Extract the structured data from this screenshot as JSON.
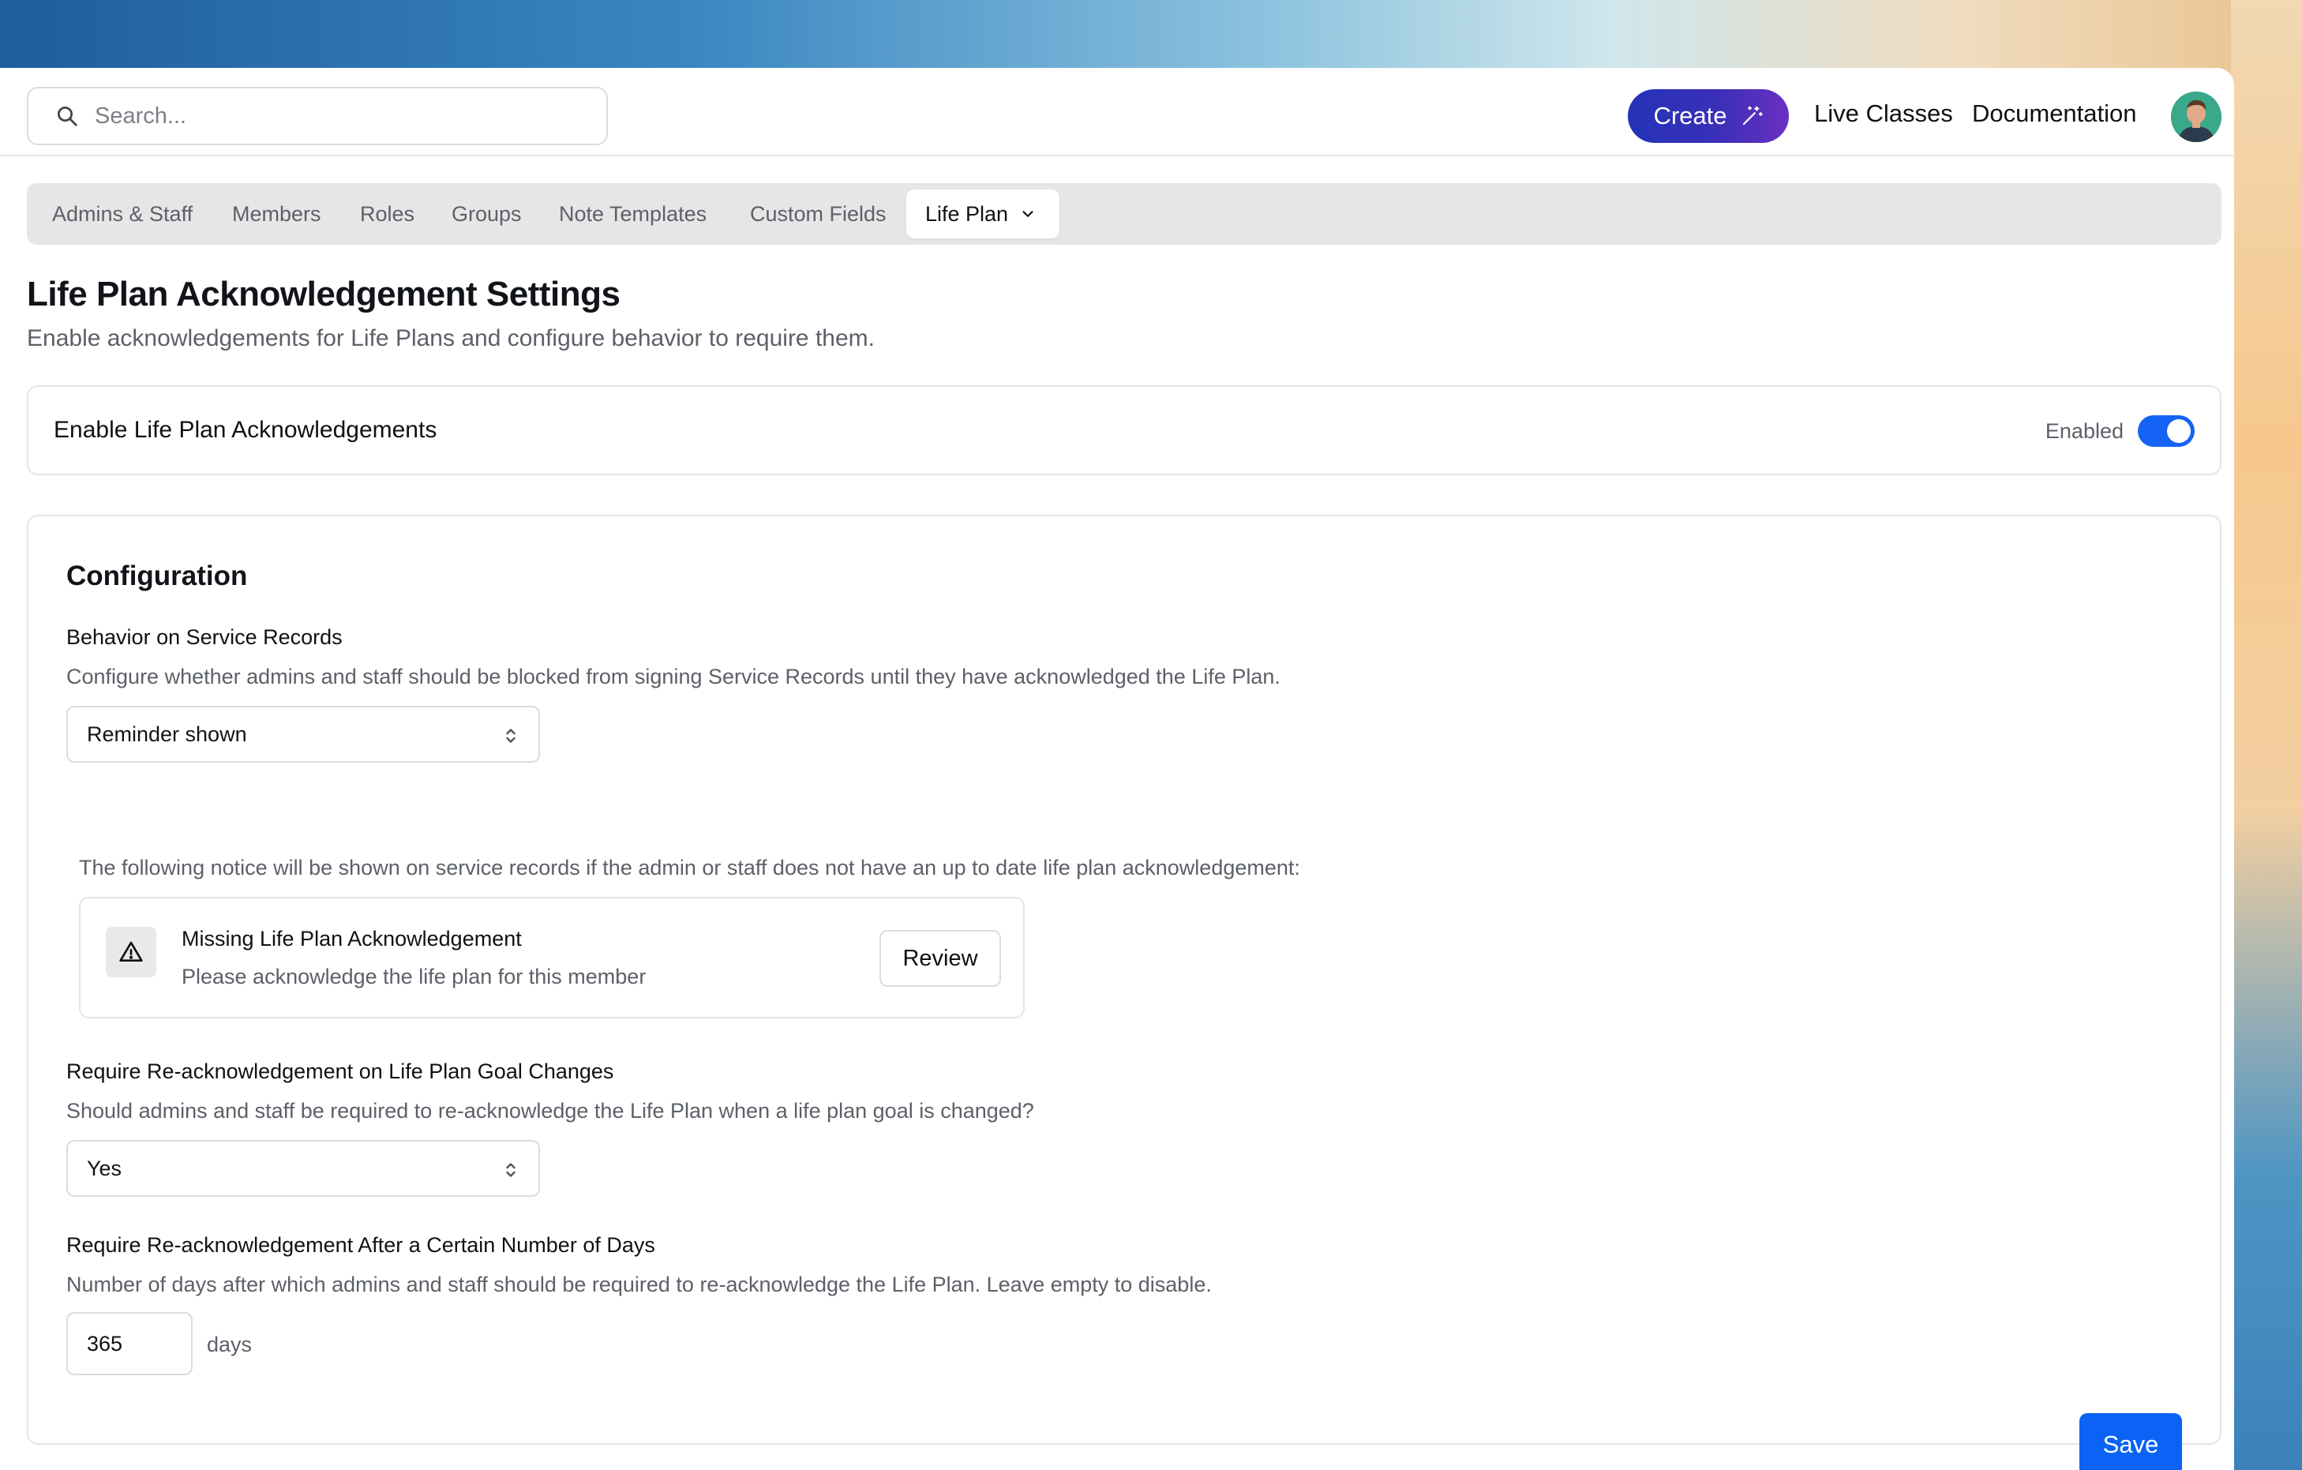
{
  "header": {
    "search": {
      "placeholder": "Search..."
    },
    "create_label": "Create",
    "links": [
      "Live Classes",
      "Documentation"
    ]
  },
  "tabs": {
    "items": [
      "Admins & Staff",
      "Members",
      "Roles",
      "Groups",
      "Note Templates",
      "Custom Fields"
    ],
    "active": "Life Plan"
  },
  "page": {
    "title": "Life Plan Acknowledgement Settings",
    "subtitle": "Enable acknowledgements for Life Plans and configure behavior to require them."
  },
  "enable_card": {
    "label": "Enable Life Plan Acknowledgements",
    "status": "Enabled",
    "toggle_on": true
  },
  "configuration": {
    "title": "Configuration",
    "behavior": {
      "label": "Behavior on Service Records",
      "description": "Configure whether admins and staff should be blocked from signing Service Records until they have acknowledged the Life Plan.",
      "value": "Reminder shown",
      "notice_intro": "The following notice will be shown on service records if the admin or staff does not have an up to date life plan acknowledgement:",
      "notice": {
        "title": "Missing Life Plan Acknowledgement",
        "text": "Please acknowledge the life plan for this member",
        "button": "Review",
        "icon": "warning-triangle-icon"
      }
    },
    "goal_changes": {
      "label": "Require Re-acknowledgement on Life Plan Goal Changes",
      "description": "Should admins and staff be required to re-acknowledge the Life Plan when a life plan goal is changed?",
      "value": "Yes"
    },
    "days": {
      "label": "Require Re-acknowledgement After a Certain Number of Days",
      "description": "Number of days after which admins and staff should be required to re-acknowledge the Life Plan. Leave empty to disable.",
      "value": "365",
      "unit": "days"
    },
    "save_label": "Save"
  },
  "colors": {
    "primary": "#0b63f6",
    "create_gradient_start": "#2433b8",
    "create_gradient_end": "#6b2fc2",
    "toggle": "#1463f5"
  }
}
